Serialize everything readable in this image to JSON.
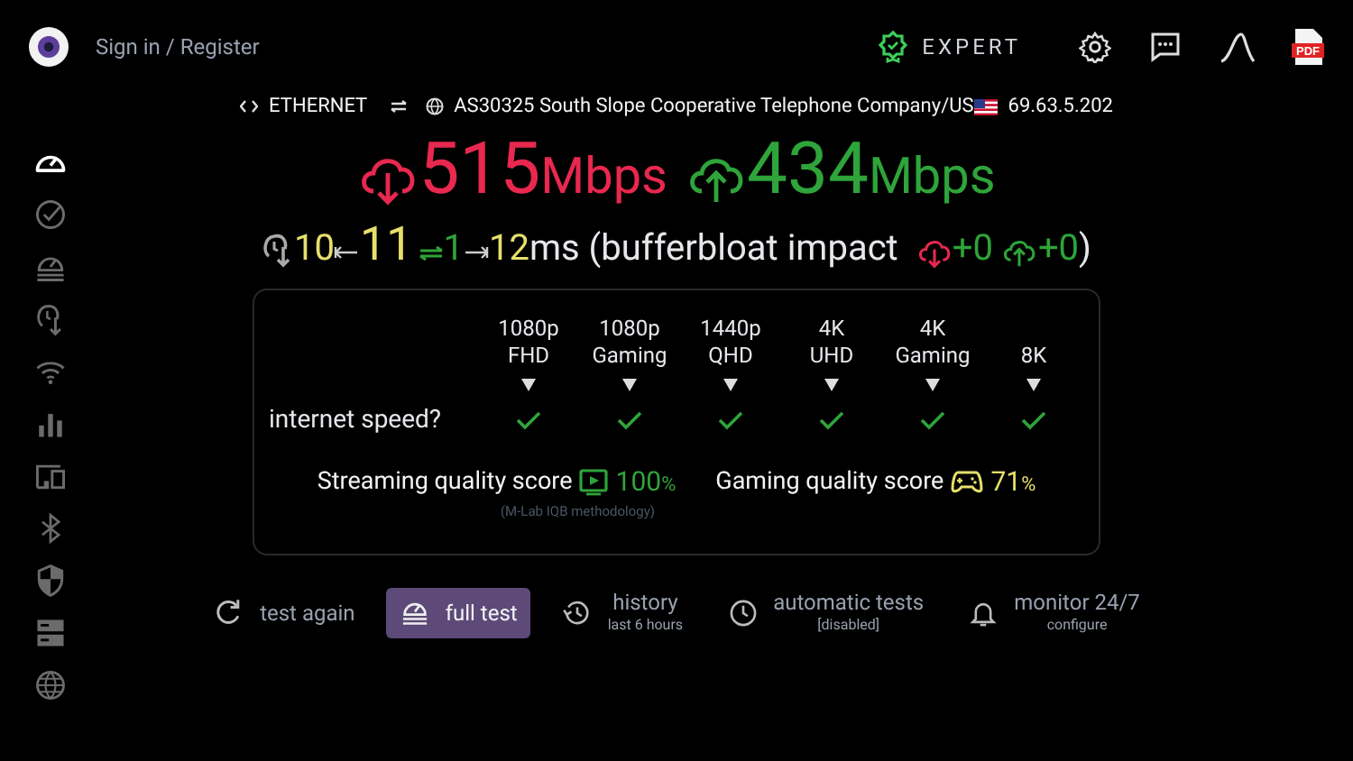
{
  "header": {
    "sign_in": "Sign in / Register",
    "expert_label": "EXPERT",
    "pdf_label": "PDF"
  },
  "connection": {
    "type": "ETHERNET",
    "isp": "AS30325 South Slope Cooperative Telephone Company/US",
    "ip": "69.63.5.202"
  },
  "sidebar": [
    {
      "kind": "gauge",
      "selected": true
    },
    {
      "kind": "check",
      "selected": false
    },
    {
      "kind": "gauge-stack",
      "selected": false
    },
    {
      "kind": "ping",
      "selected": false
    },
    {
      "kind": "wifi",
      "selected": false
    },
    {
      "kind": "bars",
      "selected": false
    },
    {
      "kind": "devices",
      "selected": false
    },
    {
      "kind": "bluetooth",
      "selected": false
    },
    {
      "kind": "shield",
      "selected": false
    },
    {
      "kind": "server",
      "selected": false
    },
    {
      "kind": "globe",
      "selected": false
    }
  ],
  "speed": {
    "download": "515",
    "download_unit": "Mbps",
    "upload": "434",
    "upload_unit": "Mbps"
  },
  "latency": {
    "idle": "10",
    "loaded": "11",
    "jitter": "1",
    "max": "12",
    "suffix": "ms (bufferbloat impact",
    "down_impact": "+0",
    "up_impact": "+0",
    "close": ")"
  },
  "quality": {
    "columns": [
      {
        "line1": "1080p",
        "line2": "FHD",
        "ok": true
      },
      {
        "line1": "1080p",
        "line2": "Gaming",
        "ok": true
      },
      {
        "line1": "1440p",
        "line2": "QHD",
        "ok": true
      },
      {
        "line1": "4K",
        "line2": "UHD",
        "ok": true
      },
      {
        "line1": "4K",
        "line2": "Gaming",
        "ok": true
      },
      {
        "line2": "8K",
        "ok": true
      }
    ],
    "row_label": "internet speed?",
    "streaming_label": "Streaming quality score",
    "streaming_value": "100",
    "streaming_unit": "%",
    "gaming_label": "Gaming quality score",
    "gaming_value": "71",
    "gaming_unit": "%",
    "methodology": "(M-Lab IQB methodology)"
  },
  "actions": [
    {
      "kind": "refresh",
      "label": "test again",
      "selected": false
    },
    {
      "kind": "gauge",
      "label": "full test",
      "selected": true
    },
    {
      "kind": "history",
      "label": "history",
      "sublabel": "last 6 hours",
      "selected": false
    },
    {
      "kind": "clock",
      "label": "automatic tests",
      "sublabel": "[disabled]",
      "selected": false
    },
    {
      "kind": "bell",
      "label": "monitor 24/7",
      "sublabel": "configure",
      "selected": false
    }
  ]
}
